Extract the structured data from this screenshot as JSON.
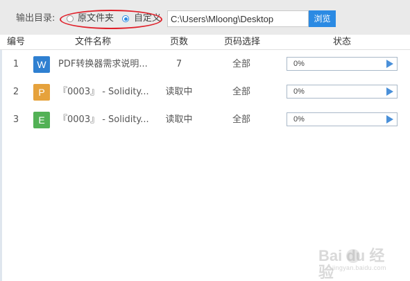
{
  "output_dir": {
    "label": "输出目录:",
    "option_original": "原文件夹",
    "option_custom": "自定义",
    "selected": "custom",
    "path": "C:\\Users\\Mloong\\Desktop",
    "browse_label": "浏览"
  },
  "table": {
    "headers": {
      "index": "编号",
      "name": "文件名称",
      "pages": "页数",
      "range": "页码选择",
      "status": "状态"
    },
    "rows": [
      {
        "index": "1",
        "type_letter": "W",
        "type_color": "#2f80d1",
        "name": "PDF转换器需求说明...",
        "pages": "7",
        "range": "全部",
        "status_text": "0%",
        "progress": 0
      },
      {
        "index": "2",
        "type_letter": "P",
        "type_color": "#e6a23c",
        "name": "『0003』 - Solidity...",
        "pages": "读取中",
        "range": "全部",
        "status_text": "0%",
        "progress": 0
      },
      {
        "index": "3",
        "type_letter": "E",
        "type_color": "#52b155",
        "name": "『0003』 - Solidity...",
        "pages": "读取中",
        "range": "全部",
        "status_text": "0%",
        "progress": 0
      }
    ]
  },
  "watermark": {
    "brand": "Bai du 经验",
    "sub": "jingyan.baidu.com"
  }
}
